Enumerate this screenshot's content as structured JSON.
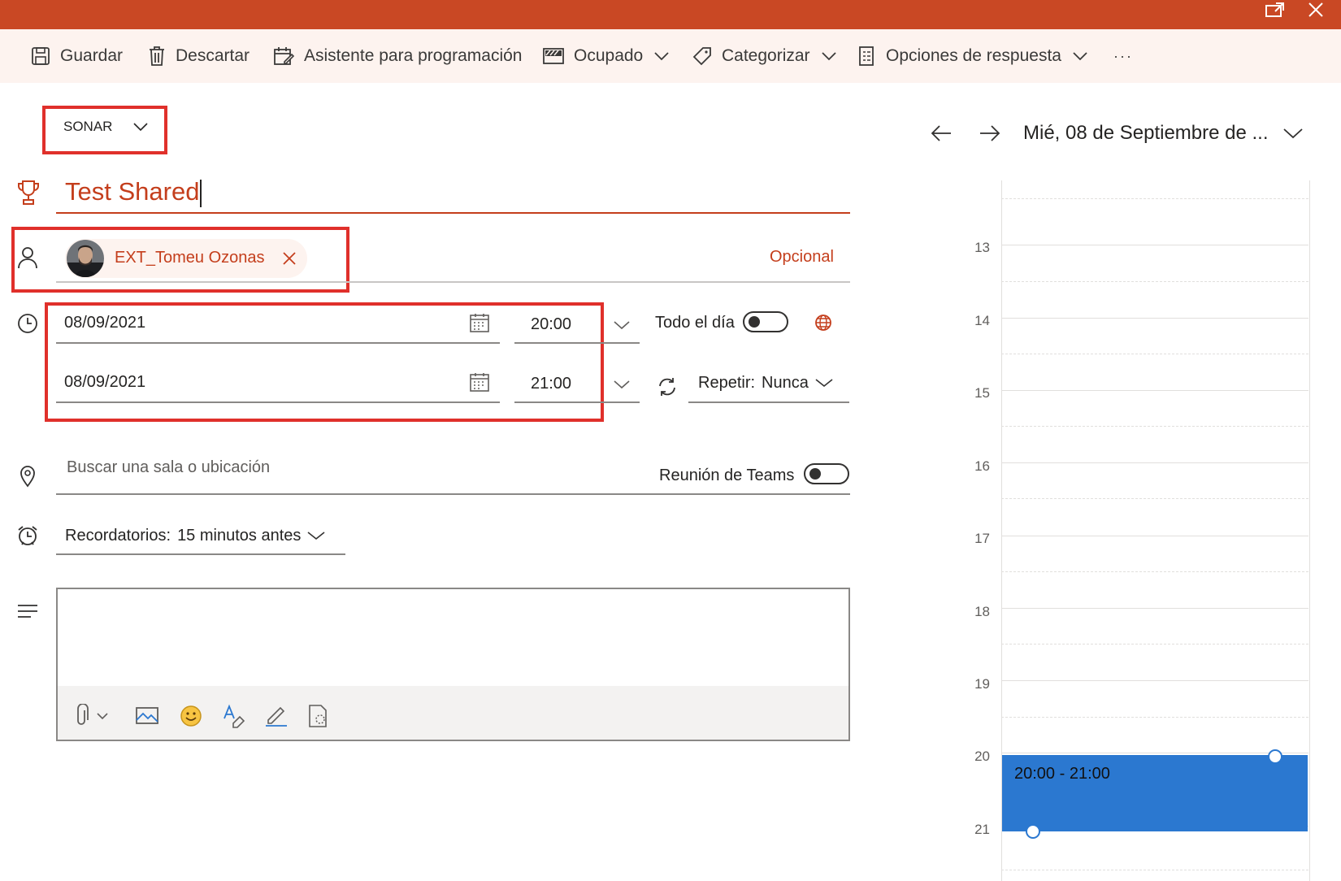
{
  "colors": {
    "brand": "#c94824",
    "accent_text": "#c43e1c",
    "event": "#2b78d0",
    "highlight": "#e0302b"
  },
  "toolbar": {
    "save": "Guardar",
    "discard": "Descartar",
    "scheduling": "Asistente para programación",
    "busy": "Ocupado",
    "categorize": "Categorizar",
    "response": "Opciones de respuesta",
    "more": "···"
  },
  "form": {
    "calendar_label": "SONAR",
    "title": "Test Shared",
    "attendee_name": "EXT_Tomeu Ozonas",
    "optional": "Opcional",
    "start_date": "08/09/2021",
    "start_time": "20:00",
    "end_date": "08/09/2021",
    "end_time": "21:00",
    "all_day": "Todo el día",
    "repeat_label": "Repetir:",
    "repeat_value": "Nunca",
    "location_placeholder": "Buscar una sala o ubicación",
    "teams_label": "Reunión de Teams",
    "reminder_label": "Recordatorios:",
    "reminder_value": "15 minutos antes"
  },
  "calendar": {
    "date_label": "Mié, 08 de Septiembre de ...",
    "hours": [
      "13",
      "14",
      "15",
      "16",
      "17",
      "18",
      "19",
      "20",
      "21"
    ],
    "event_time": "20:00 - 21:00"
  }
}
